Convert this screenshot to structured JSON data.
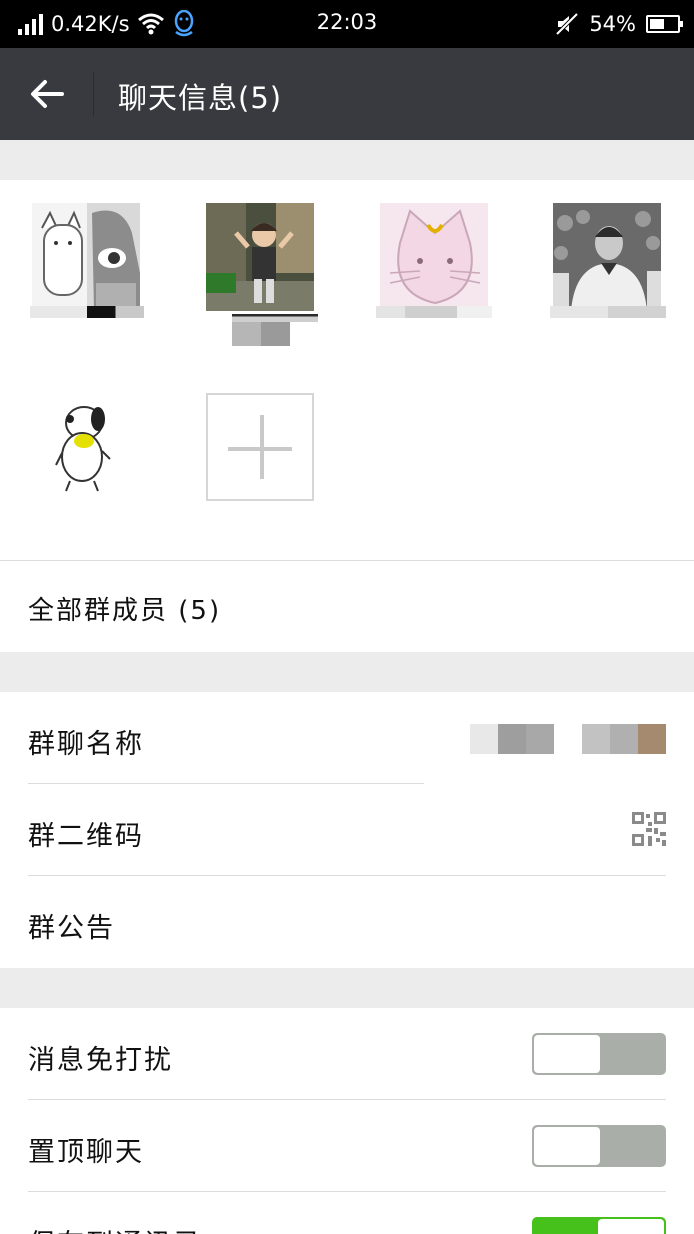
{
  "status_bar": {
    "network_speed": "0.42K/s",
    "time": "22:03",
    "battery_percent": "54%",
    "battery_level": 0.54,
    "icons": [
      "signal-icon",
      "wifi-icon",
      "qq-icon",
      "mute-icon",
      "battery-icon"
    ]
  },
  "header": {
    "back_icon": "arrow-left-icon",
    "title": "聊天信息(5)"
  },
  "members": {
    "avatars": [
      "avatar-cat-girl",
      "avatar-girl-photo",
      "avatar-sailor-cat",
      "avatar-football-player",
      "avatar-snoopy"
    ],
    "add_icon": "plus-icon",
    "all_members_label": "全部群成员 (5)"
  },
  "settings_group_1": {
    "group_name_label": "群聊名称",
    "group_qr_label": "群二维码",
    "qr_icon": "qr-code-icon",
    "group_notice_label": "群公告"
  },
  "settings_group_2": {
    "mute_label": "消息免打扰",
    "mute_on": false,
    "pin_label": "置顶聊天",
    "pin_on": false,
    "save_contacts_label": "保存到通讯录",
    "save_contacts_on": true
  },
  "colors": {
    "header_bg": "#393a3f",
    "status_bg": "#000000",
    "page_bg": "#ececec",
    "toggle_on": "#46c01b",
    "toggle_off": "#a9aea8"
  }
}
